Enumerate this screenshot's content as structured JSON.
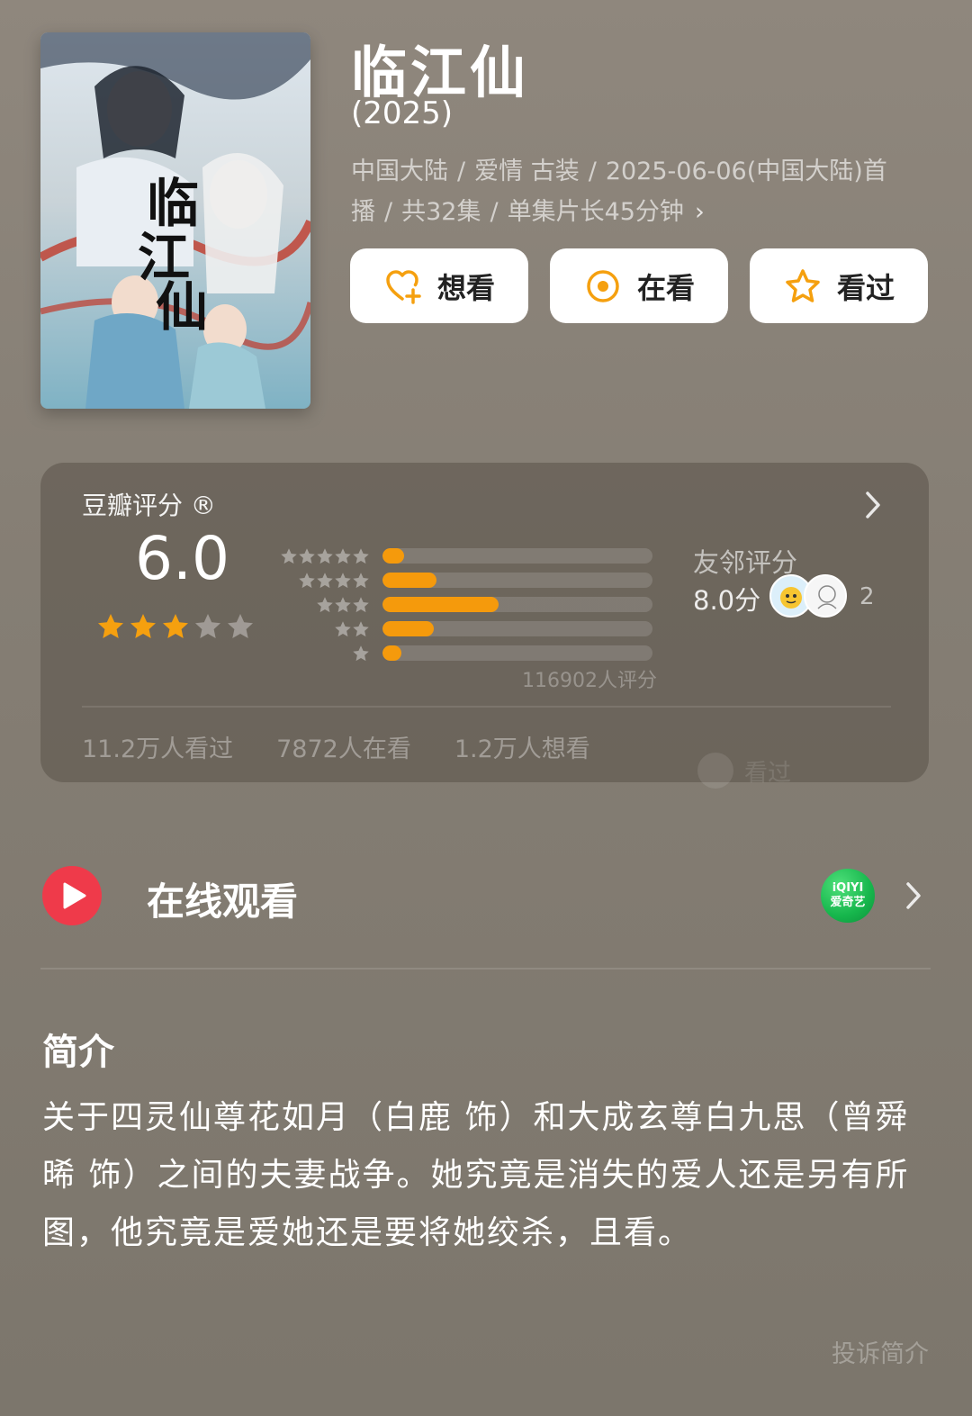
{
  "movie": {
    "title": "临江仙",
    "year": "(2025)",
    "meta_line1": [
      "中国大陆",
      "爱情 古装",
      "2025-06-06(中国大陆)首"
    ],
    "meta_line2": [
      "播",
      "共32集",
      "单集片长45分钟"
    ],
    "separator": "/",
    "chevron": "›"
  },
  "actions": [
    {
      "label": "想看",
      "icon": "heart-plus-icon"
    },
    {
      "label": "在看",
      "icon": "target-circle-icon"
    },
    {
      "label": "看过",
      "icon": "star-outline-icon"
    }
  ],
  "rating": {
    "label": "豆瓣评分 ®",
    "score": "6.0",
    "stars_filled": 3,
    "stars_total": 5,
    "distribution": [
      {
        "stars": 5,
        "fraction": 0.08
      },
      {
        "stars": 4,
        "fraction": 0.2
      },
      {
        "stars": 3,
        "fraction": 0.43
      },
      {
        "stars": 2,
        "fraction": 0.19
      },
      {
        "stars": 1,
        "fraction": 0.07
      }
    ],
    "count_label": "116902人评分",
    "friend_label": "友邻评分",
    "friend_score": "8.0分",
    "friend_count": "2",
    "stats": [
      "11.2万人看过",
      "7872人在看",
      "1.2万人想看"
    ],
    "ghost_label": "看过"
  },
  "watch": {
    "label": "在线观看",
    "platform_line1": "iQIYI",
    "platform_line2": "爱奇艺"
  },
  "intro": {
    "title": "简介",
    "text": "关于四灵仙尊花如月（白鹿 饰）和大成玄尊白九思（曾舜晞 饰）之间的夫妻战争。她究竟是消失的爱人还是另有所图，他究竟是爱她还是要将她绞杀，且看。",
    "report": "投诉简介"
  },
  "colors": {
    "accent_orange": "#f59a0c",
    "play_red": "#ef3a4a",
    "star_gold": "#f5a00f"
  }
}
